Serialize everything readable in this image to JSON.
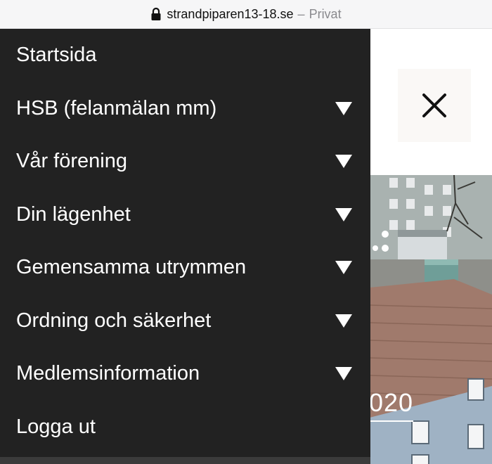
{
  "browser": {
    "domain": "strandpiparen13-18.se",
    "separator": "–",
    "mode": "Privat",
    "icon": "lock-icon"
  },
  "close_button": {
    "icon": "close-icon"
  },
  "hero": {
    "year_text": "020"
  },
  "menu": {
    "items": [
      {
        "label": "Startsida",
        "has_submenu": false
      },
      {
        "label": "HSB (felanmälan mm)",
        "has_submenu": true
      },
      {
        "label": "Vår förening",
        "has_submenu": true
      },
      {
        "label": "Din lägenhet",
        "has_submenu": true
      },
      {
        "label": "Gemensamma utrymmen",
        "has_submenu": true
      },
      {
        "label": "Ordning och säkerhet",
        "has_submenu": true
      },
      {
        "label": "Medlemsinformation",
        "has_submenu": true
      },
      {
        "label": "Logga ut",
        "has_submenu": false
      }
    ]
  },
  "colors": {
    "drawer_bg": "#222222",
    "menu_text": "#ffffff",
    "url_bar_bg": "#f6f6f7"
  }
}
